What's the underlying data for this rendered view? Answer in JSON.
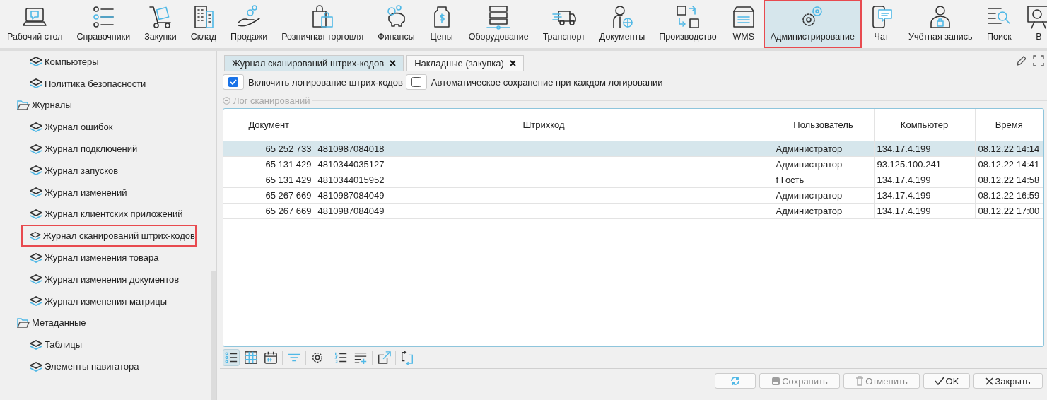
{
  "toolbar": {
    "items": [
      {
        "label": "Рабочий стол",
        "selected": false,
        "highlighted": false
      },
      {
        "label": "Справочники",
        "selected": false,
        "highlighted": false
      },
      {
        "label": "Закупки",
        "selected": false,
        "highlighted": false
      },
      {
        "label": "Склад",
        "selected": false,
        "highlighted": false
      },
      {
        "label": "Продажи",
        "selected": false,
        "highlighted": false
      },
      {
        "label": "Розничная торговля",
        "selected": false,
        "highlighted": false
      },
      {
        "label": "Финансы",
        "selected": false,
        "highlighted": false
      },
      {
        "label": "Цены",
        "selected": false,
        "highlighted": false
      },
      {
        "label": "Оборудование",
        "selected": false,
        "highlighted": false
      },
      {
        "label": "Транспорт",
        "selected": false,
        "highlighted": false
      },
      {
        "label": "Документы",
        "selected": false,
        "highlighted": false
      },
      {
        "label": "Производство",
        "selected": false,
        "highlighted": false
      },
      {
        "label": "WMS",
        "selected": false,
        "highlighted": false
      },
      {
        "label": "Администрирование",
        "selected": true,
        "highlighted": true
      },
      {
        "label": "Чат",
        "selected": false,
        "highlighted": false
      },
      {
        "label": "Учётная запись",
        "selected": false,
        "highlighted": false
      },
      {
        "label": "Поиск",
        "selected": false,
        "highlighted": false
      },
      {
        "label": "В",
        "selected": false,
        "highlighted": false
      }
    ]
  },
  "sidebar": {
    "continued_items": [
      {
        "label": "Компьютеры",
        "highlighted": false
      },
      {
        "label": "Политика безопасности",
        "highlighted": false
      }
    ],
    "folders": [
      {
        "label": "Журналы",
        "children": [
          {
            "label": "Журнал ошибок",
            "highlighted": false
          },
          {
            "label": "Журнал подключений",
            "highlighted": false
          },
          {
            "label": "Журнал запусков",
            "highlighted": false
          },
          {
            "label": "Журнал изменений",
            "highlighted": false
          },
          {
            "label": "Журнал клиентских приложений",
            "highlighted": false
          },
          {
            "label": "Журнал сканирований штрих-кодов",
            "highlighted": true
          },
          {
            "label": "Журнал изменения товара",
            "highlighted": false
          },
          {
            "label": "Журнал изменения документов",
            "highlighted": false
          },
          {
            "label": "Журнал изменения матрицы",
            "highlighted": false
          }
        ]
      },
      {
        "label": "Метаданные",
        "children": [
          {
            "label": "Таблицы",
            "highlighted": false
          },
          {
            "label": "Элементы навигатора",
            "highlighted": false
          }
        ]
      }
    ]
  },
  "tabs": [
    {
      "label": "Журнал сканирований штрих-кодов",
      "selected": true
    },
    {
      "label": "Накладные (закупка)",
      "selected": false
    }
  ],
  "options": [
    {
      "label": "Включить логирование штрих-кодов",
      "checked": true
    },
    {
      "label": "Автоматическое сохранение при каждом логировании",
      "checked": false
    }
  ],
  "section": {
    "title": "Лог сканирований",
    "expanded": true
  },
  "table": {
    "columns": [
      "Документ",
      "Штрихкод",
      "Пользователь",
      "Компьютер",
      "Время"
    ],
    "rows": [
      {
        "cells": [
          "65 252 733",
          "4810987084018",
          "Администратор",
          "134.17.4.199",
          "08.12.22 14:14"
        ],
        "selected": true
      },
      {
        "cells": [
          "65 131 429",
          "4810344035127",
          "Администратор",
          "93.125.100.241",
          "08.12.22 14:41"
        ],
        "selected": false
      },
      {
        "cells": [
          "65 131 429",
          "4810344015952",
          "f Гость",
          "134.17.4.199",
          "08.12.22 14:58"
        ],
        "selected": false
      },
      {
        "cells": [
          "65 267 669",
          "4810987084049",
          "Администратор",
          "134.17.4.199",
          "08.12.22 16:59"
        ],
        "selected": false
      },
      {
        "cells": [
          "65 267 669",
          "4810987084049",
          "Администратор",
          "134.17.4.199",
          "08.12.22 17:00"
        ],
        "selected": false
      }
    ]
  },
  "grid_tools": [
    {
      "selected": true
    },
    {
      "selected": false
    },
    {
      "selected": false
    },
    {
      "selected": false
    },
    {
      "selected": false
    },
    {
      "selected": false
    },
    {
      "selected": false
    },
    {
      "selected": false
    },
    {
      "selected": false
    }
  ],
  "buttons": [
    {
      "kind": "icon",
      "disabled": false
    },
    {
      "kind": "text",
      "label": "Сохранить",
      "disabled": true
    },
    {
      "kind": "text",
      "label": "Отменить",
      "disabled": true
    },
    {
      "kind": "text",
      "label": "OK",
      "disabled": false
    },
    {
      "kind": "text",
      "label": "Закрыть",
      "disabled": false
    }
  ]
}
